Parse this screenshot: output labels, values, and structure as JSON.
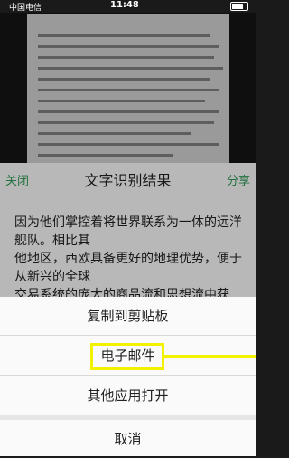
{
  "status": {
    "carrier": "中国电信",
    "time": "11:48"
  },
  "header": {
    "close": "关闭",
    "title": "文字识别结果",
    "share": "分享"
  },
  "result_text": "因为他们掌控着将世界联系为一体的远洋舰队。相比其\n他地区，西欧具备更好的地理优势，便于从新兴的全球\n交易系统的庞大的商品流和思想流中获",
  "actions": {
    "copy": "复制到剪贴板",
    "email": "电子邮件",
    "other_apps": "其他应用打开",
    "cancel": "取消"
  }
}
